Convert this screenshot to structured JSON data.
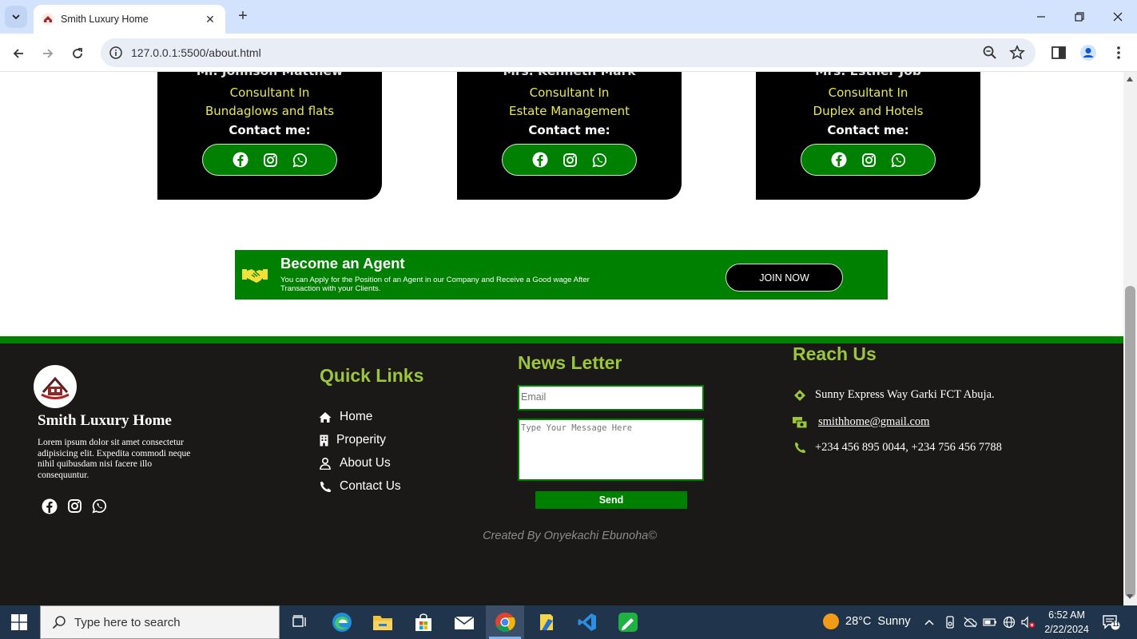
{
  "browser": {
    "tab_title": "Smith Luxury Home",
    "url": "127.0.0.1:5500/about.html"
  },
  "agents": [
    {
      "name": "Mr. Johnson Matthew",
      "role_line1": "Consultant In",
      "role_line2": "Bundaglows and flats",
      "contact_label": "Contact me:"
    },
    {
      "name": "Mrs. Kenneth Mark",
      "role_line1": "Consultant In",
      "role_line2": "Estate Management",
      "contact_label": "Contact me:"
    },
    {
      "name": "Mrs. Esther Job",
      "role_line1": "Consultant In",
      "role_line2": "Duplex and Hotels",
      "contact_label": "Contact me:"
    }
  ],
  "banner": {
    "title": "Become an Agent",
    "text": "You can Apply for the Position of an Agent in our Company and Receive a Good wage After Transaction with your Clients.",
    "button": "JOIN NOW"
  },
  "footer": {
    "brand": "Smith Luxury Home",
    "description": "Lorem ipsum dolor sit amet consectetur adipisicing elit. Expedita commodi neque nihil quibusdam nisi facere illo consequuntur.",
    "quick_links_title": "Quick Links",
    "quick_links": [
      "Home",
      "Properity",
      "About Us",
      "Contact Us"
    ],
    "newsletter_title": "News Letter",
    "email_placeholder": "Email",
    "message_placeholder": "Type Your Message Here",
    "send_label": "Send",
    "reach_title": "Reach Us",
    "address": "Sunny Express Way Garki FCT Abuja.",
    "email": "smithhome@gmail.com",
    "phone": "+234 456 895 0044, +234 756 456 7788",
    "credit": "Created By Onyekachi Ebunoha©"
  },
  "taskbar": {
    "search_placeholder": "Type here to search",
    "temperature": "28°C",
    "weather": "Sunny",
    "time": "6:52 AM",
    "date": "2/22/2024",
    "notification_count": "11"
  },
  "colors": {
    "accent_green": "#008000",
    "title_green": "#9bc53d",
    "footer_bg": "#1b1918",
    "role_yellow": "#e8e85a"
  }
}
